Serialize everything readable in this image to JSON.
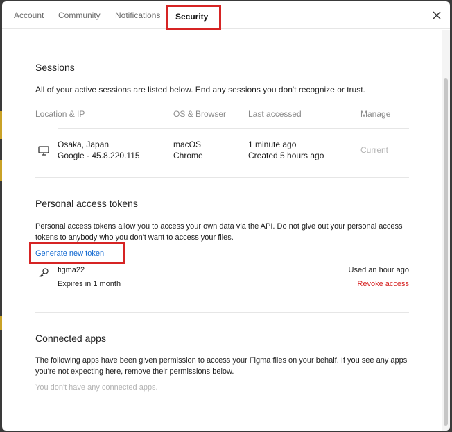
{
  "tabs": [
    {
      "label": "Account"
    },
    {
      "label": "Community"
    },
    {
      "label": "Notifications"
    },
    {
      "label": "Security"
    }
  ],
  "sessions": {
    "title": "Sessions",
    "description": "All of your active sessions are listed below. End any sessions you don't recognize or trust.",
    "columns": {
      "location": "Location & IP",
      "os": "OS & Browser",
      "accessed": "Last accessed",
      "manage": "Manage"
    },
    "rows": [
      {
        "location": "Osaka, Japan",
        "ip": "Google · 45.8.220.115",
        "os": "macOS",
        "browser": "Chrome",
        "last_accessed": "1 minute ago",
        "created": "Created 5 hours ago",
        "manage": "Current"
      }
    ]
  },
  "tokens": {
    "title": "Personal access tokens",
    "description": "Personal access tokens allow you to access your own data via the API. Do not give out your personal access tokens to anybody who you don't want to access your files.",
    "generate_label": "Generate new token",
    "items": [
      {
        "name": "figma22",
        "expires": "Expires in 1 month",
        "used": "Used an hour ago",
        "revoke": "Revoke access"
      }
    ]
  },
  "connected": {
    "title": "Connected apps",
    "description": "The following apps have been given permission to access your Figma files on your behalf. If you see any apps you're not expecting here, remove their permissions below.",
    "empty": "You don't have any connected apps."
  },
  "colors": {
    "accent_link": "#0d66d0",
    "danger": "#d62424",
    "highlight_box": "#d62424"
  }
}
